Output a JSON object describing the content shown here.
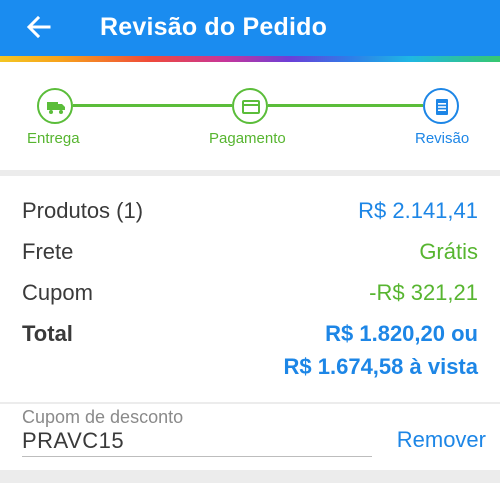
{
  "appbar": {
    "title": "Revisão do Pedido",
    "color": "#1a8cf0"
  },
  "steps": [
    {
      "label": "Entrega",
      "icon": "truck-icon",
      "state": "done"
    },
    {
      "label": "Pagamento",
      "icon": "credit-card-icon",
      "state": "done"
    },
    {
      "label": "Revisão",
      "icon": "receipt-icon",
      "state": "current"
    }
  ],
  "summary": {
    "products_label": "Produtos (1)",
    "products_value": "R$ 2.141,41",
    "shipping_label": "Frete",
    "shipping_value": "Grátis",
    "coupon_label": "Cupom",
    "coupon_value": "-R$ 321,21",
    "total_label": "Total",
    "total_value": "R$ 1.820,20 ou",
    "total_cash_value": "R$ 1.674,58 à vista"
  },
  "coupon": {
    "field_label": "Cupom de desconto",
    "code": "PRAVC15",
    "remove_label": "Remover"
  },
  "colors": {
    "accent": "#1d86e6",
    "success": "#57b530"
  }
}
